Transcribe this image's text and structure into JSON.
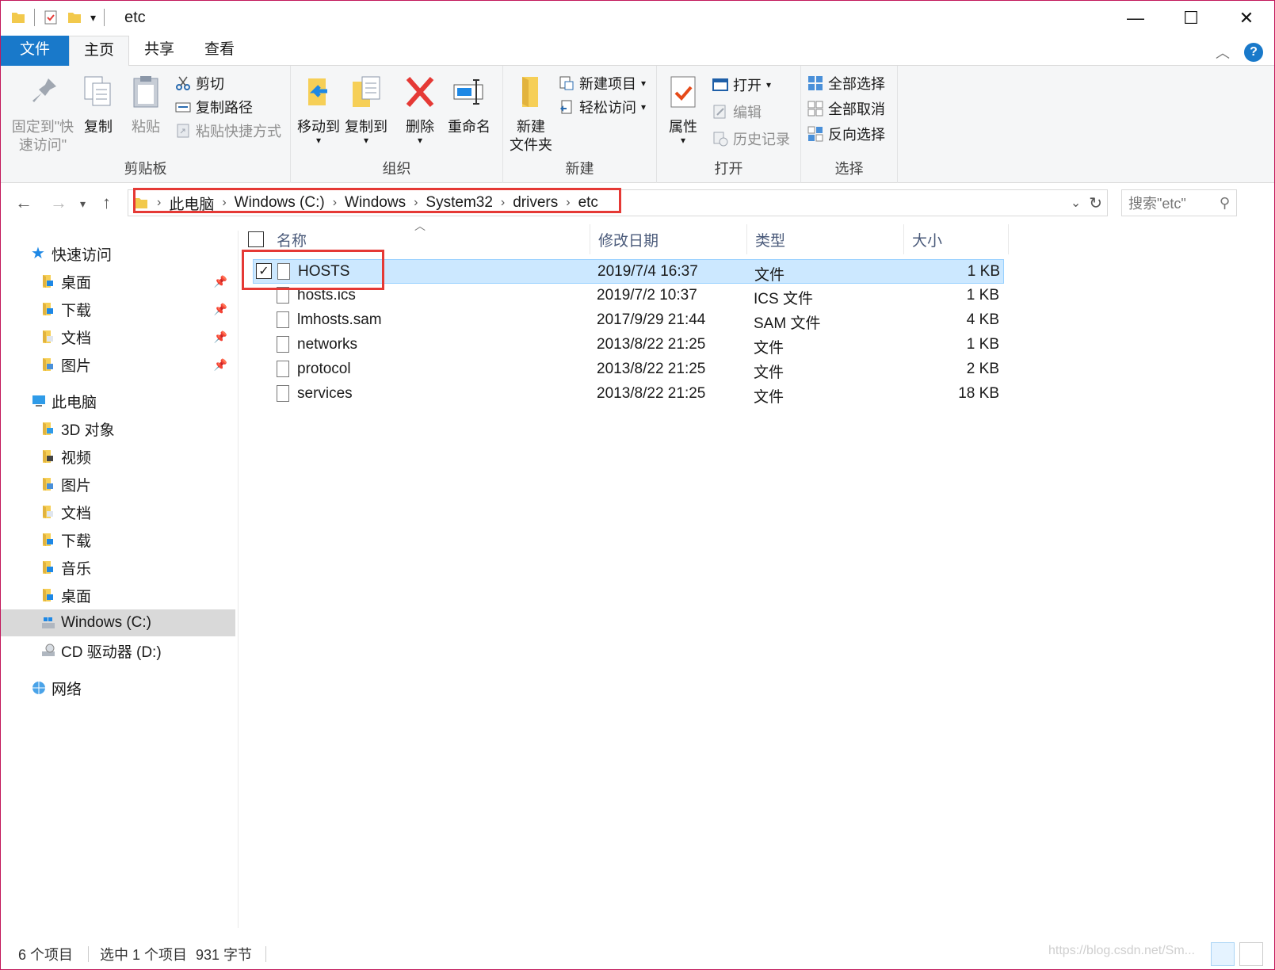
{
  "window": {
    "title": "etc",
    "min": "—",
    "max": "☐",
    "close": "✕"
  },
  "tabs": {
    "file": "文件",
    "home": "主页",
    "share": "共享",
    "view": "查看"
  },
  "ribbon": {
    "clipboard": {
      "label": "剪贴板",
      "pin": "固定到\"快速访问\"",
      "copy": "复制",
      "paste": "粘贴",
      "cut": "剪切",
      "copy_path": "复制路径",
      "paste_shortcut": "粘贴快捷方式"
    },
    "organize": {
      "label": "组织",
      "move_to": "移动到",
      "copy_to": "复制到",
      "delete": "删除",
      "rename": "重命名"
    },
    "new": {
      "label": "新建",
      "new_folder": "新建\n文件夹",
      "new_item": "新建项目",
      "easy_access": "轻松访问"
    },
    "open": {
      "label": "打开",
      "properties": "属性",
      "open": "打开",
      "edit": "编辑",
      "history": "历史记录"
    },
    "select": {
      "label": "选择",
      "select_all": "全部选择",
      "select_none": "全部取消",
      "invert": "反向选择"
    }
  },
  "address": {
    "crumbs": [
      "此电脑",
      "Windows (C:)",
      "Windows",
      "System32",
      "drivers",
      "etc"
    ],
    "search_placeholder": "搜索\"etc\""
  },
  "sidebar": {
    "quick_access": "快速访问",
    "quick_items": [
      "桌面",
      "下载",
      "文档",
      "图片"
    ],
    "this_pc": "此电脑",
    "pc_items": [
      "3D 对象",
      "视频",
      "图片",
      "文档",
      "下载",
      "音乐",
      "桌面",
      "Windows (C:)",
      "CD 驱动器 (D:)"
    ],
    "network": "网络"
  },
  "columns": {
    "name": "名称",
    "modified": "修改日期",
    "type": "类型",
    "size": "大小"
  },
  "files": [
    {
      "name": "HOSTS",
      "modified": "2019/7/4 16:37",
      "type": "文件",
      "size": "1 KB"
    },
    {
      "name": "hosts.ics",
      "modified": "2019/7/2 10:37",
      "type": "ICS 文件",
      "size": "1 KB"
    },
    {
      "name": "lmhosts.sam",
      "modified": "2017/9/29 21:44",
      "type": "SAM 文件",
      "size": "4 KB"
    },
    {
      "name": "networks",
      "modified": "2013/8/22 21:25",
      "type": "文件",
      "size": "1 KB"
    },
    {
      "name": "protocol",
      "modified": "2013/8/22 21:25",
      "type": "文件",
      "size": "2 KB"
    },
    {
      "name": "services",
      "modified": "2013/8/22 21:25",
      "type": "文件",
      "size": "18 KB"
    }
  ],
  "status": {
    "count": "6 个项目",
    "selected": "选中 1 个项目",
    "size": "931 字节"
  },
  "watermark": "https://blog.csdn.net/Sm...",
  "colors": {
    "accent": "#1979ca",
    "selection": "#cce8ff",
    "highlight": "#e53935"
  }
}
